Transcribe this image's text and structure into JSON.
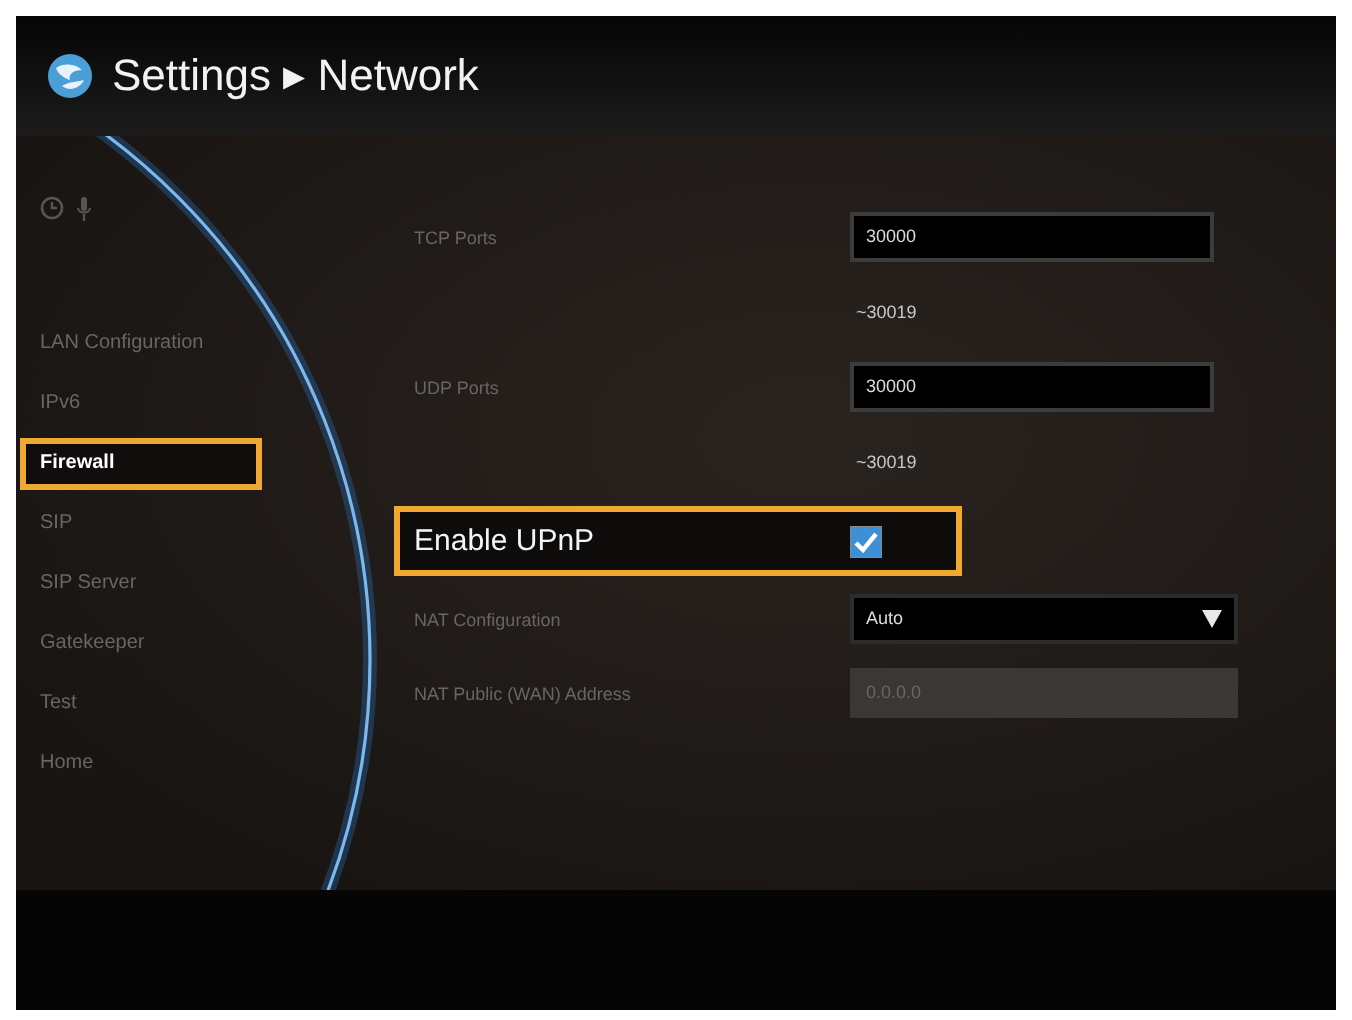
{
  "header": {
    "title": "Settings ▸ Network"
  },
  "sidebar": {
    "items": [
      {
        "label": "LAN Configuration",
        "selected": false
      },
      {
        "label": "IPv6",
        "selected": false
      },
      {
        "label": "Firewall",
        "selected": true
      },
      {
        "label": "SIP",
        "selected": false
      },
      {
        "label": "SIP Server",
        "selected": false
      },
      {
        "label": "Gatekeeper",
        "selected": false
      },
      {
        "label": "Test",
        "selected": false
      },
      {
        "label": "Home",
        "selected": false
      }
    ]
  },
  "form": {
    "rows": [
      {
        "kind": "text",
        "label": "TCP Ports",
        "value": "30000",
        "note": "~30019",
        "focused": false,
        "disabled": false
      },
      {
        "kind": "text",
        "label": "UDP Ports",
        "value": "30000",
        "note": "~30019",
        "focused": false,
        "disabled": false
      },
      {
        "kind": "checkbox",
        "label": "Enable UPnP",
        "checked": true,
        "focused": true
      },
      {
        "kind": "select",
        "label": "NAT Configuration",
        "value": "Auto",
        "focused": false
      },
      {
        "kind": "text",
        "label": "NAT Public (WAN) Address",
        "value": "0.0.0.0",
        "focused": false,
        "disabled": true
      }
    ]
  }
}
